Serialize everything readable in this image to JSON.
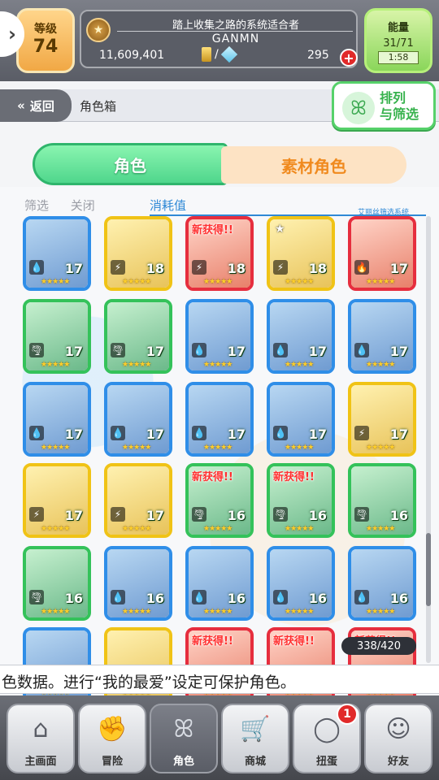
{
  "header": {
    "level_label": "等级",
    "level": "74",
    "subtitle": "踏上收集之路的系统适合者",
    "player_name": "GANMN",
    "coins": "11,609,401",
    "currency_separator": "/",
    "gems": "295",
    "energy_label": "能量",
    "energy": "31/71",
    "energy_timer": "1:58"
  },
  "nav_bar": {
    "back_label": "返回",
    "page_title": "角色箱",
    "sort_label_1": "排列",
    "sort_label_2": "与筛选"
  },
  "tabs": {
    "characters": "角色",
    "materials": "素材角色"
  },
  "filter": {
    "filter_label": "筛选",
    "filter_state": "关闭",
    "sort_key": "消耗值",
    "system_label": "艾丽丝筛选系统"
  },
  "cards": [
    {
      "level": "17",
      "level_prefix": "1",
      "new": false,
      "fav": false,
      "element": "water",
      "color": "blue"
    },
    {
      "level": "18",
      "new": false,
      "fav": false,
      "element": "thunder",
      "color": "yellow"
    },
    {
      "level": "18",
      "new": true,
      "fav": false,
      "element": "thunder",
      "color": "red"
    },
    {
      "level": "18",
      "new": false,
      "fav": true,
      "element": "thunder",
      "color": "yellow"
    },
    {
      "level": "17",
      "new": false,
      "fav": false,
      "element": "fire",
      "color": "red"
    },
    {
      "level": "17",
      "new": false,
      "fav": false,
      "element": "wind",
      "color": "green"
    },
    {
      "level": "17",
      "new": false,
      "fav": false,
      "element": "wind",
      "color": "green"
    },
    {
      "level": "17",
      "new": false,
      "fav": false,
      "element": "water",
      "color": "blue"
    },
    {
      "level": "17",
      "new": false,
      "fav": false,
      "element": "water",
      "color": "blue"
    },
    {
      "level": "17",
      "new": false,
      "fav": false,
      "element": "water",
      "color": "blue"
    },
    {
      "level": "17",
      "new": false,
      "fav": false,
      "element": "water",
      "color": "blue"
    },
    {
      "level": "17",
      "new": false,
      "fav": false,
      "element": "water",
      "color": "blue"
    },
    {
      "level": "17",
      "new": false,
      "fav": false,
      "element": "water",
      "color": "blue"
    },
    {
      "level": "17",
      "new": false,
      "fav": false,
      "element": "water",
      "color": "blue"
    },
    {
      "level": "17",
      "new": false,
      "fav": false,
      "element": "thunder",
      "color": "yellow"
    },
    {
      "level": "17",
      "new": false,
      "fav": false,
      "element": "thunder",
      "color": "yellow"
    },
    {
      "level": "17",
      "new": false,
      "fav": false,
      "element": "thunder",
      "color": "yellow"
    },
    {
      "level": "16",
      "new": true,
      "fav": false,
      "element": "wind",
      "color": "green"
    },
    {
      "level": "16",
      "new": true,
      "fav": false,
      "element": "wind",
      "color": "green"
    },
    {
      "level": "16",
      "new": false,
      "fav": false,
      "element": "wind",
      "color": "green"
    },
    {
      "level": "16",
      "new": false,
      "fav": false,
      "element": "wind",
      "color": "green"
    },
    {
      "level": "16",
      "new": false,
      "fav": false,
      "element": "water",
      "color": "blue"
    },
    {
      "level": "16",
      "new": false,
      "fav": false,
      "element": "water",
      "color": "blue"
    },
    {
      "level": "16",
      "new": false,
      "fav": false,
      "element": "water",
      "color": "blue"
    },
    {
      "level": "16",
      "new": false,
      "fav": false,
      "element": "water",
      "color": "blue"
    },
    {
      "level": "",
      "new": false,
      "fav": false,
      "element": "water",
      "color": "blue"
    },
    {
      "level": "",
      "new": false,
      "fav": false,
      "element": "fire",
      "color": "yellow"
    },
    {
      "level": "",
      "new": true,
      "fav": false,
      "element": "fire",
      "color": "red"
    },
    {
      "level": "",
      "new": true,
      "fav": false,
      "element": "fire",
      "color": "red"
    },
    {
      "level": "",
      "new": true,
      "fav": false,
      "element": "fire",
      "color": "red"
    }
  ],
  "new_tag": "新获得!!",
  "box_count": "338/420",
  "ticker": "色数据。进行“我的最爱”设定可保护角色。",
  "bottom_nav": [
    {
      "label": "主画面",
      "icon": "home-icon"
    },
    {
      "label": "冒险",
      "icon": "handshake-icon"
    },
    {
      "label": "角色",
      "icon": "rabbit-icon"
    },
    {
      "label": "商城",
      "icon": "cart-icon"
    },
    {
      "label": "扭蛋",
      "icon": "egg-icon"
    },
    {
      "label": "好友",
      "icon": "friends-icon"
    }
  ],
  "gacha_badge": "1",
  "colors": {
    "blue": "#2f8ee8",
    "yellow": "#f0c316",
    "red": "#e62e3e",
    "green": "#34c25a",
    "accent_green": "#4fd68c",
    "accent_orange": "#f08a1e"
  }
}
